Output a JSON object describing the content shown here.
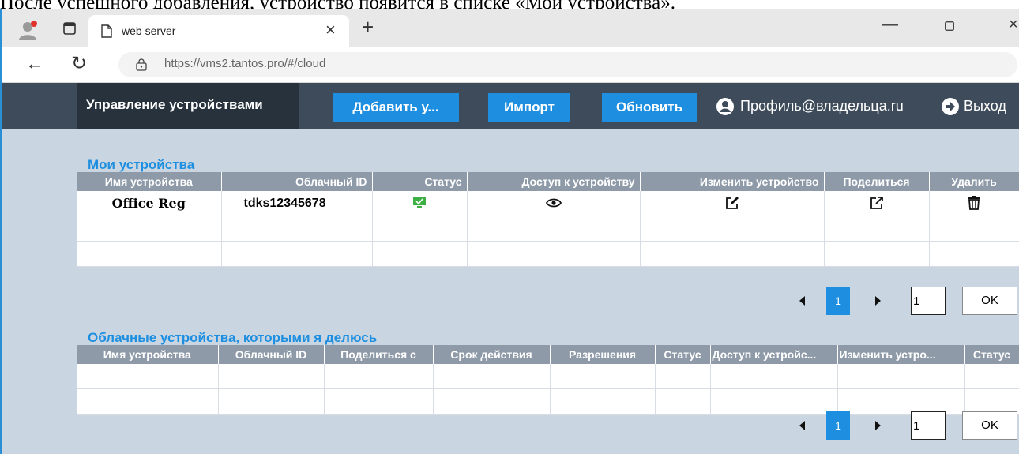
{
  "caption": "После успешного добавления, устройство появится в списке «Мои устройства».",
  "browser": {
    "tab_title": "web server",
    "url_host": "https://vms2.tantos.pro",
    "url_path": "/#/cloud",
    "icons": [
      "profile-avatar",
      "tab-actions-icon",
      "page-icon",
      "close-icon",
      "plus-icon",
      "minimize-icon",
      "maximize-icon",
      "back-arrow-icon",
      "reload-icon",
      "site-info-icon"
    ]
  },
  "navbar": {
    "title": "Управление устройствами",
    "add_label": "Добавить у...",
    "import_label": "Импорт",
    "refresh_label": "Обновить",
    "profile_label": "Профиль@владельца.ru",
    "logout_label": "Выход",
    "accent_color": "#1e8fe0"
  },
  "my_devices": {
    "title": "Мои устройства",
    "columns": [
      "Имя устройства",
      "Облачный ID",
      "Статус",
      "Доступ к устройству",
      "Изменить устройство",
      "Поделиться",
      "Удалить"
    ],
    "rows": [
      {
        "name": "Office Reg",
        "cloud_id": "tdks12345678",
        "status_icon": "online-monitor-icon",
        "access_icon": "eye-icon",
        "edit_icon": "edit-icon",
        "share_icon": "share-icon",
        "delete_icon": "trash-icon"
      }
    ],
    "pager": {
      "current_page": "1",
      "page_input": "1",
      "ok_label": "OK"
    }
  },
  "shared_devices": {
    "title": "Облачные устройства, которыми я делюсь",
    "columns": [
      "Имя устройства",
      "Облачный ID",
      "Поделиться с",
      "Срок действия",
      "Разрешения",
      "Статус",
      "Доступ к устройс...",
      "Изменить устро...",
      "Статус"
    ],
    "pager": {
      "current_page": "1",
      "page_input": "1",
      "ok_label": "OK"
    }
  }
}
